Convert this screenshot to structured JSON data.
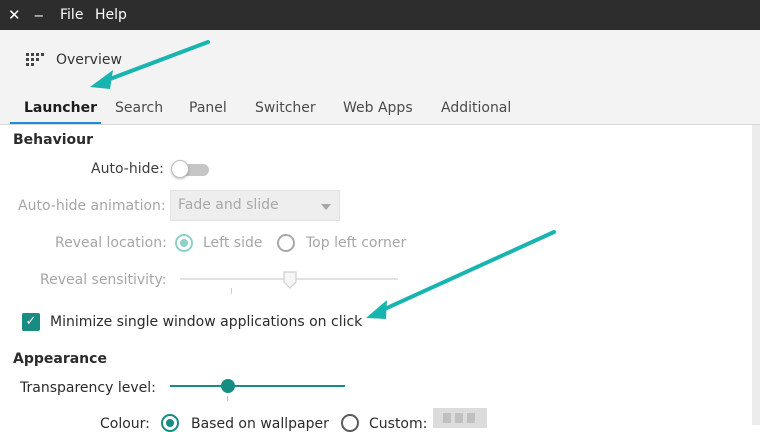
{
  "window": {
    "close_glyph": "✕",
    "minimize_glyph": "‒",
    "menu": [
      "File",
      "Help"
    ]
  },
  "toolbar": {
    "overview_label": "Overview",
    "overview_icon": "grid-icon"
  },
  "tabs": [
    "Launcher",
    "Search",
    "Panel",
    "Switcher",
    "Web Apps",
    "Additional"
  ],
  "active_tab": "Launcher",
  "behaviour": {
    "title": "Behaviour",
    "autohide_label": "Auto-hide:",
    "autohide_enabled": false,
    "autohide_animation_label": "Auto-hide animation:",
    "autohide_animation_value": "Fade and slide",
    "reveal_location_label": "Reveal location:",
    "reveal_options": [
      "Left side",
      "Top left corner"
    ],
    "reveal_selected": "Left side",
    "reveal_sensitivity_label": "Reveal sensitivity:",
    "reveal_sensitivity_fraction": 0.5,
    "minimize_label": "Minimize single window applications on click",
    "minimize_checked": true
  },
  "appearance": {
    "title": "Appearance",
    "transparency_label": "Transparency level:",
    "transparency_fraction": 0.33,
    "colour_label": "Colour:",
    "colour_options": [
      "Based on wallpaper",
      "Custom:"
    ],
    "colour_selected": "Based on wallpaper"
  },
  "colors": {
    "accent": "#178c83",
    "annotation_arrow": "#18b5b0",
    "tab_underline": "#1a8fd8",
    "titlebar": "#2d2d2d"
  }
}
